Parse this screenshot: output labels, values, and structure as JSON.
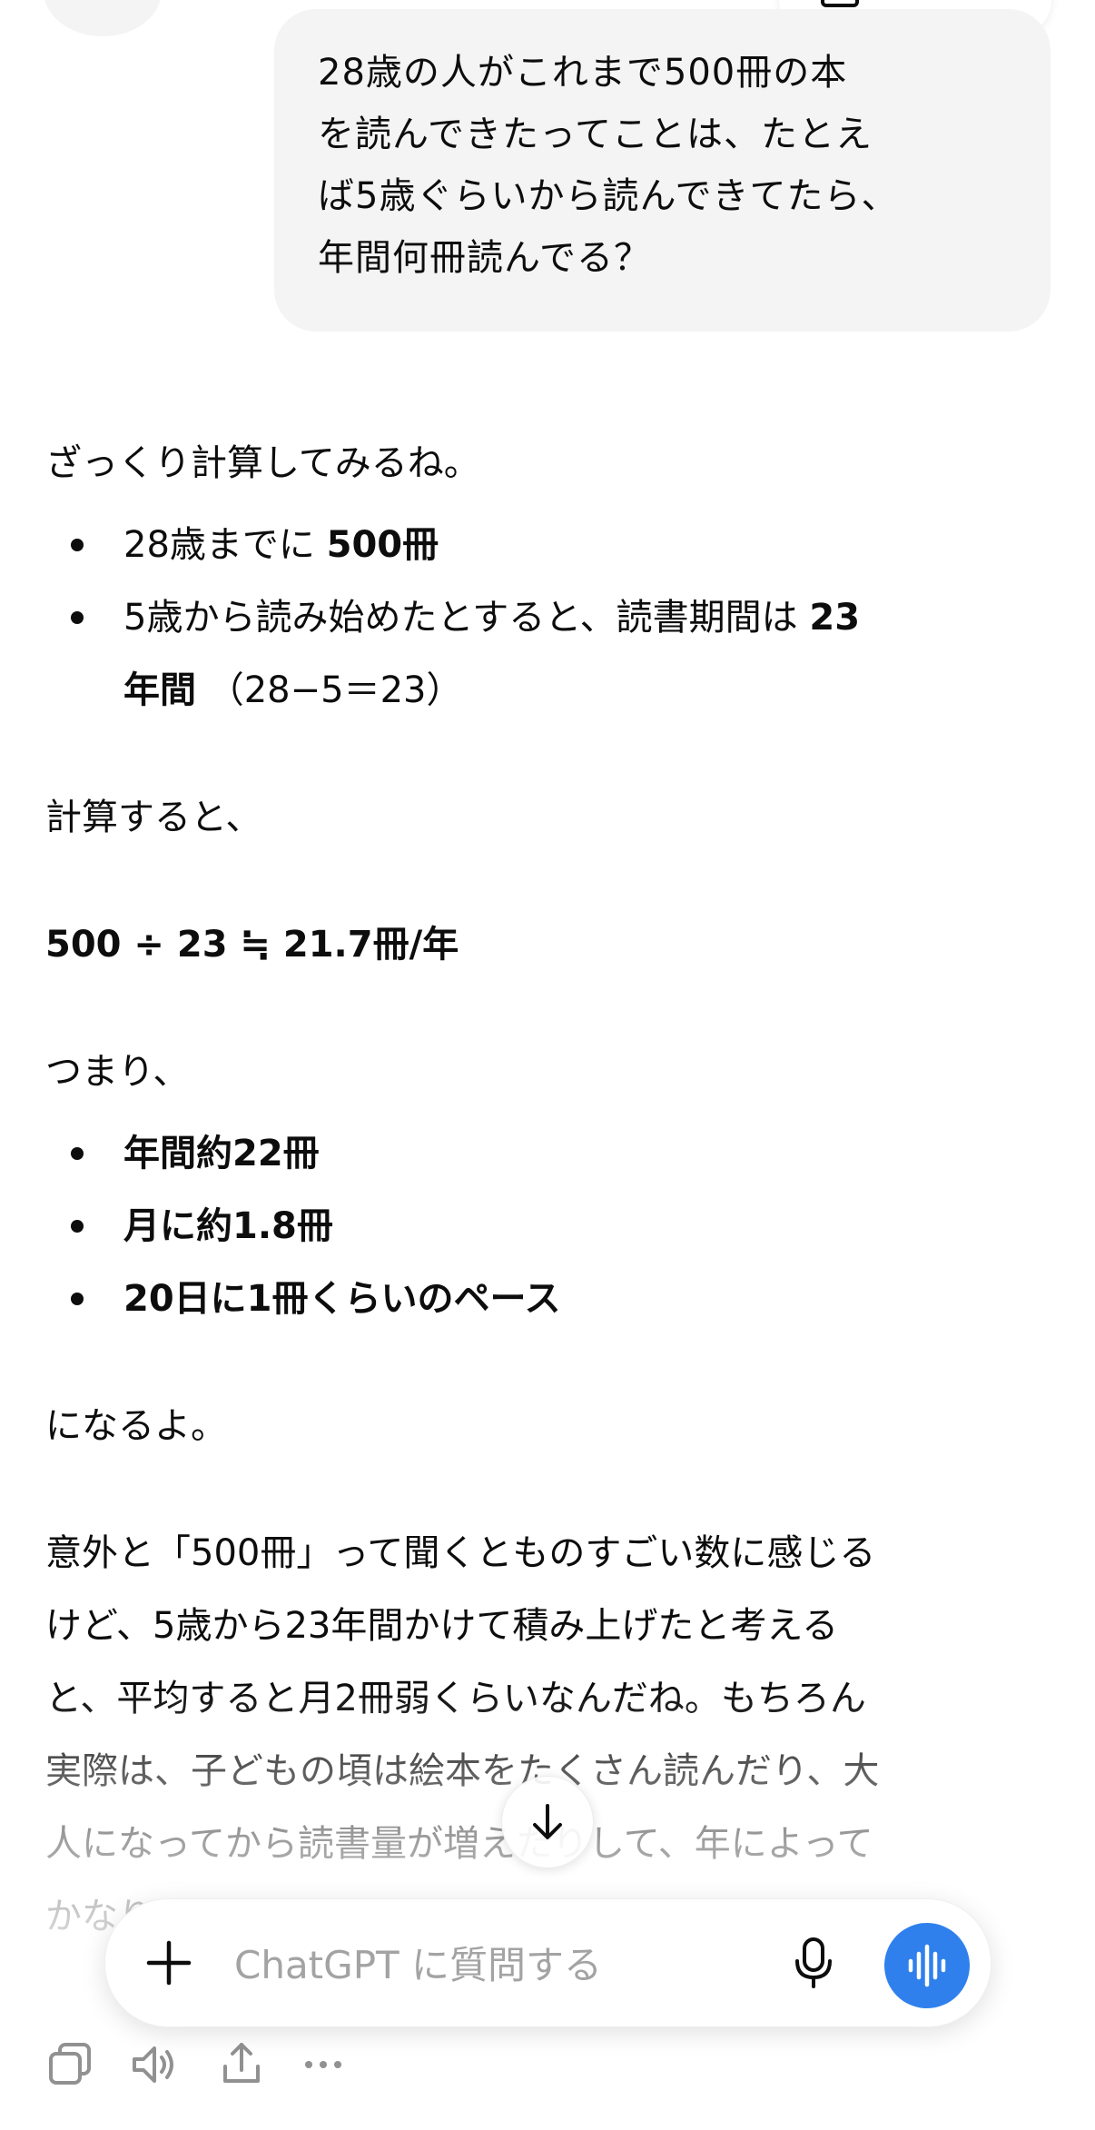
{
  "user_message": {
    "lines": [
      "28歳の人がこれまで500冊の本",
      "を読んできたってことは、たとえ",
      "ば5歳ぐらいから読んできてたら、",
      "年間何冊読んでる？"
    ]
  },
  "assistant": {
    "intro": "ざっくり計算してみるね。",
    "bullets1": {
      "item1": {
        "text": "28歳までに ",
        "bold": "500冊"
      },
      "item2": {
        "text": "5歳から読み始めたとすると、読書期間は ",
        "bold_a": "23",
        "bold_b": "年間",
        "tail": "（28−5＝23）"
      }
    },
    "calc_intro": "計算すると、",
    "formula": "500 ÷ 23 ≒ 21.7冊/年",
    "summary_intro": "つまり、",
    "bullets2": [
      "年間約22冊",
      "月に約1.8冊",
      "20日に1冊くらいのペース"
    ],
    "closing": "になるよ。",
    "para_lines": [
      "意外と「500冊」って聞くとものすごい数に感じる",
      "けど、5歳から23年間かけて積み上げたと考える",
      "と、平均すると月2冊弱くらいなんだね。もちろん",
      "実際は、子どもの頃は絵本をたくさん読んだり、大",
      "人になってから読書量が増えたりして、年によって",
      "かなり"
    ]
  },
  "composer": {
    "placeholder": "ChatGPT に質問する"
  },
  "icons": {
    "plus": "plus-icon",
    "mic": "microphone-icon",
    "voice": "voice-waveform-icon",
    "scroll": "arrow-down-icon",
    "copy": "copy-icon",
    "speaker": "speaker-icon",
    "share": "share-icon",
    "more": "more-icon"
  },
  "colors": {
    "accent": "#2f80ed",
    "bubble": "#f4f4f4",
    "text": "#0d0d0d"
  }
}
